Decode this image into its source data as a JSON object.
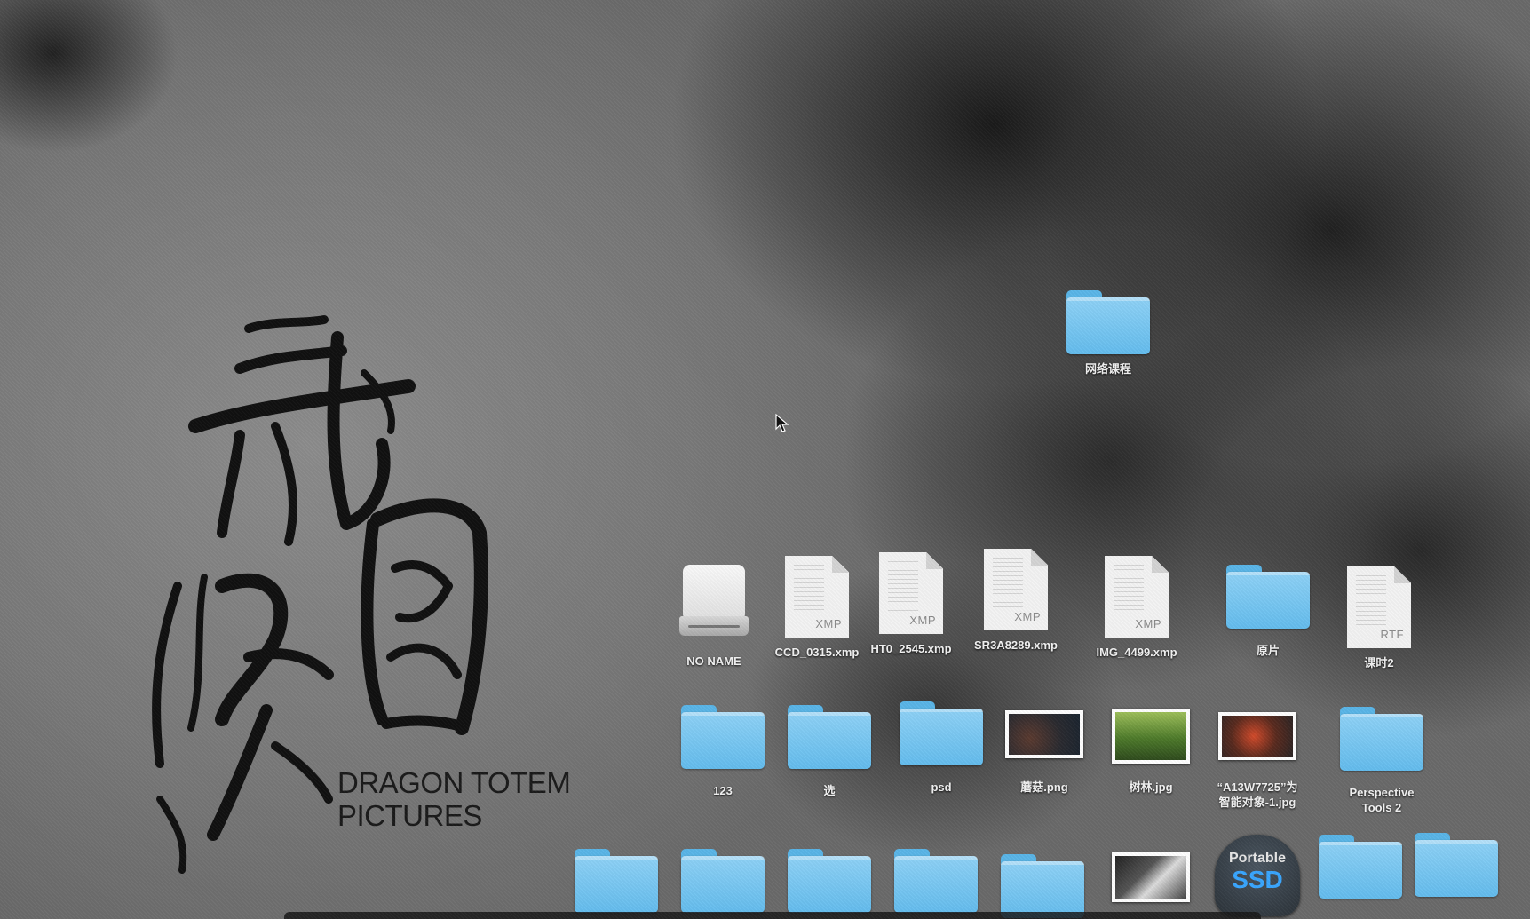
{
  "desktop": {
    "wallpaper": {
      "logo_line1": "DRAGON TOTEM",
      "logo_line2": "PICTURES",
      "logo_calligraphy": "龍圖騰"
    },
    "icons": [
      {
        "id": "folder-network-course",
        "label": "网络课程",
        "type": "folder"
      },
      {
        "id": "drive-no-name",
        "label": "NO NAME",
        "type": "drive"
      },
      {
        "id": "file-ccd-0315",
        "label": "CCD_0315.xmp",
        "type": "document",
        "ext": "XMP"
      },
      {
        "id": "file-ht0-2545",
        "label": "HT0_2545.xmp",
        "type": "document",
        "ext": "XMP"
      },
      {
        "id": "file-sr3a8289",
        "label": "SR3A8289.xmp",
        "type": "document",
        "ext": "XMP"
      },
      {
        "id": "file-img-4499",
        "label": "IMG_4499.xmp",
        "type": "document",
        "ext": "XMP"
      },
      {
        "id": "folder-original",
        "label": "原片",
        "type": "folder"
      },
      {
        "id": "file-lesson2",
        "label": "课时2",
        "type": "document",
        "ext": "RTF"
      },
      {
        "id": "folder-123",
        "label": "123",
        "type": "folder"
      },
      {
        "id": "folder-select",
        "label": "选",
        "type": "folder"
      },
      {
        "id": "folder-psd",
        "label": "psd",
        "type": "folder"
      },
      {
        "id": "image-mushroom",
        "label": "蘑菇.png",
        "type": "image"
      },
      {
        "id": "image-forest",
        "label": "树林.jpg",
        "type": "image"
      },
      {
        "id": "image-a13w7725",
        "label": "“A13W7725”为\n智能对象-1.jpg",
        "type": "image"
      },
      {
        "id": "folder-perspective-tools",
        "label": "Perspective\nTools 2",
        "type": "folder"
      }
    ],
    "ssd": {
      "line1": "Portable",
      "line2": "SSD"
    }
  },
  "colors": {
    "folder_blue": "#6cc3f2",
    "ssd_blue": "#39a6ff",
    "label_text": "#f2f2f2"
  }
}
